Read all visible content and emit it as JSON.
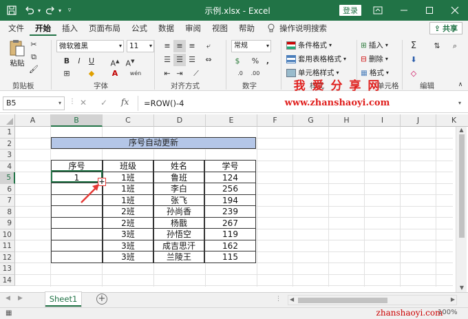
{
  "window": {
    "title": "示例.xlsx - Excel",
    "login_label": "登录"
  },
  "menu": {
    "items": [
      "文件",
      "开始",
      "插入",
      "页面布局",
      "公式",
      "数据",
      "审阅",
      "视图",
      "帮助"
    ],
    "search_label": "操作说明搜索",
    "share_label": "共享"
  },
  "ribbon": {
    "paste_label": "粘贴",
    "font_name": "微软雅黑",
    "font_size": "11",
    "number_format": "常规",
    "conditional_format": "条件格式",
    "table_format": "套用表格格式",
    "cell_style": "单元格样式",
    "insert_label": "插入",
    "delete_label": "删除",
    "format_label": "格式",
    "groups": {
      "clipboard": "剪贴板",
      "font": "字体",
      "alignment": "对齐方式",
      "number": "数字",
      "styles": "样式",
      "cells": "单元格",
      "editing": "编辑"
    }
  },
  "watermark": {
    "title": "我 爱 分 享 网",
    "url": "www.zhanshaoyi.com",
    "url_bottom": "zhanshaoyi.com"
  },
  "formula_bar": {
    "name_box": "B5",
    "fx": "fx",
    "formula": "=ROW()-4"
  },
  "sheet": {
    "columns": [
      "A",
      "B",
      "C",
      "D",
      "E",
      "F",
      "G",
      "H",
      "I",
      "J",
      "K"
    ],
    "rows": [
      "1",
      "2",
      "3",
      "4",
      "5",
      "6",
      "7",
      "8",
      "9",
      "10",
      "11",
      "12",
      "13",
      "14"
    ],
    "table_title": "序号自动更新",
    "headers": [
      "序号",
      "班级",
      "姓名",
      "学号"
    ],
    "data": [
      [
        "1",
        "1班",
        "鲁班",
        "124"
      ],
      [
        "",
        "1班",
        "李白",
        "256"
      ],
      [
        "",
        "1班",
        "张飞",
        "194"
      ],
      [
        "",
        "2班",
        "孙尚香",
        "239"
      ],
      [
        "",
        "2班",
        "杨戬",
        "267"
      ],
      [
        "",
        "3班",
        "孙悟空",
        "119"
      ],
      [
        "",
        "3班",
        "成吉思汗",
        "162"
      ],
      [
        "",
        "3班",
        "兰陵王",
        "115"
      ]
    ],
    "tab_name": "Sheet1"
  },
  "status": {
    "zoom": "100%"
  },
  "colors": {
    "excel_green": "#217346",
    "title_fill": "#b4c6e7",
    "watermark_red": "#e0201e",
    "arrow_red": "#e53935"
  }
}
